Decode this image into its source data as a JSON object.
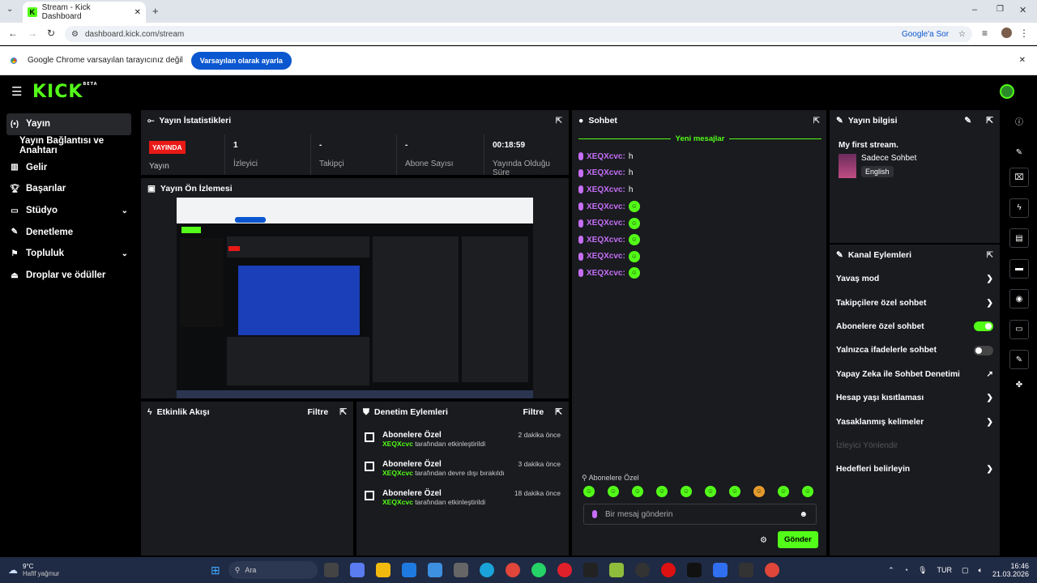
{
  "browser": {
    "tab_title": "Stream - Kick Dashboard",
    "url": "dashboard.kick.com/stream",
    "ask_google": "Google'a Sor",
    "infobar_text": "Google Chrome varsayılan tarayıcınız değil",
    "infobar_button": "Varsayılan olarak ayarla"
  },
  "brand": {
    "logo": "KICK",
    "beta": "BETA",
    "accent": "#53fc18"
  },
  "sidebar": {
    "items": [
      {
        "label": "Yayın",
        "icon": "broadcast-icon"
      },
      {
        "label": "Yayın Bağlantısı ve Anahtarı"
      },
      {
        "label": "Gelir",
        "icon": "chart-icon"
      },
      {
        "label": "Başarılar",
        "icon": "trophy-icon"
      },
      {
        "label": "Stüdyo",
        "icon": "studio-icon"
      },
      {
        "label": "Denetleme",
        "icon": "wrench-icon"
      },
      {
        "label": "Topluluk",
        "icon": "community-icon"
      },
      {
        "label": "Droplar ve ödüller",
        "icon": "drops-icon"
      }
    ]
  },
  "stats": {
    "title": "Yayın İstatistikleri",
    "live_badge": "YAYINDA",
    "live_label": "Yayın",
    "viewers": "1",
    "viewers_label": "İzleyici",
    "followers": "-",
    "followers_label": "Takipçi",
    "subs": "-",
    "subs_label": "Abone Sayısı",
    "uptime": "00:18:59",
    "uptime_label": "Yayında Olduğu Süre"
  },
  "preview": {
    "title": "Yayın Ön İzlemesi"
  },
  "activity": {
    "title": "Etkinlik Akışı",
    "filter": "Filtre"
  },
  "modlog": {
    "title": "Denetim Eylemleri",
    "filter": "Filtre",
    "items": [
      {
        "title": "Abonelere Özel",
        "user": "XEQXcvc",
        "action": "tarafından etkinleştirildi",
        "time": "2 dakika önce"
      },
      {
        "title": "Abonelere Özel",
        "user": "XEQXcvc",
        "action": "tarafından devre dışı bırakıldı",
        "time": "3 dakika önce"
      },
      {
        "title": "Abonelere Özel",
        "user": "XEQXcvc",
        "action": "tarafından etkinleştirildi",
        "time": "18 dakika önce"
      }
    ]
  },
  "chat": {
    "title": "Sohbet",
    "new_messages": "Yeni mesajlar",
    "messages": [
      {
        "user": "XEQXcvc:",
        "text": "h"
      },
      {
        "user": "XEQXcvc:",
        "text": "h"
      },
      {
        "user": "XEQXcvc:",
        "text": "h"
      },
      {
        "user": "XEQXcvc:",
        "text": ""
      },
      {
        "user": "XEQXcvc:",
        "text": ""
      },
      {
        "user": "XEQXcvc:",
        "text": ""
      },
      {
        "user": "XEQXcvc:",
        "text": ""
      },
      {
        "user": "XEQXcvc:",
        "text": ""
      }
    ],
    "mode_label": "Abonelere Özel",
    "placeholder": "Bir mesaj gönderin",
    "send": "Gönder"
  },
  "info": {
    "title": "Yayın bilgisi",
    "stream_title": "My first stream.",
    "category": "Sadece Sohbet",
    "language": "English"
  },
  "actions": {
    "title": "Kanal Eylemleri",
    "items": [
      {
        "label": "Yavaş mod",
        "type": "arrow"
      },
      {
        "label": "Takipçilere özel sohbet",
        "type": "arrow"
      },
      {
        "label": "Abonelere özel sohbet",
        "type": "toggle",
        "on": true
      },
      {
        "label": "Yalnızca ifadelerle sohbet",
        "type": "toggle",
        "on": false
      },
      {
        "label": "Yapay Zeka ile Sohbet Denetimi",
        "type": "external"
      },
      {
        "label": "Hesap yaşı kısıtlaması",
        "type": "arrow"
      },
      {
        "label": "Yasaklanmış kelimeler",
        "type": "arrow"
      },
      {
        "label": "İzleyici Yönlendir",
        "type": "disabled"
      },
      {
        "label": "Hedefleri belirleyin",
        "type": "arrow"
      }
    ]
  },
  "taskbar": {
    "weather_temp": "9°C",
    "weather_desc": "Hafif yağmur",
    "search": "Ara",
    "lang": "TUR",
    "time": "16:46",
    "date": "21.03.2026"
  }
}
